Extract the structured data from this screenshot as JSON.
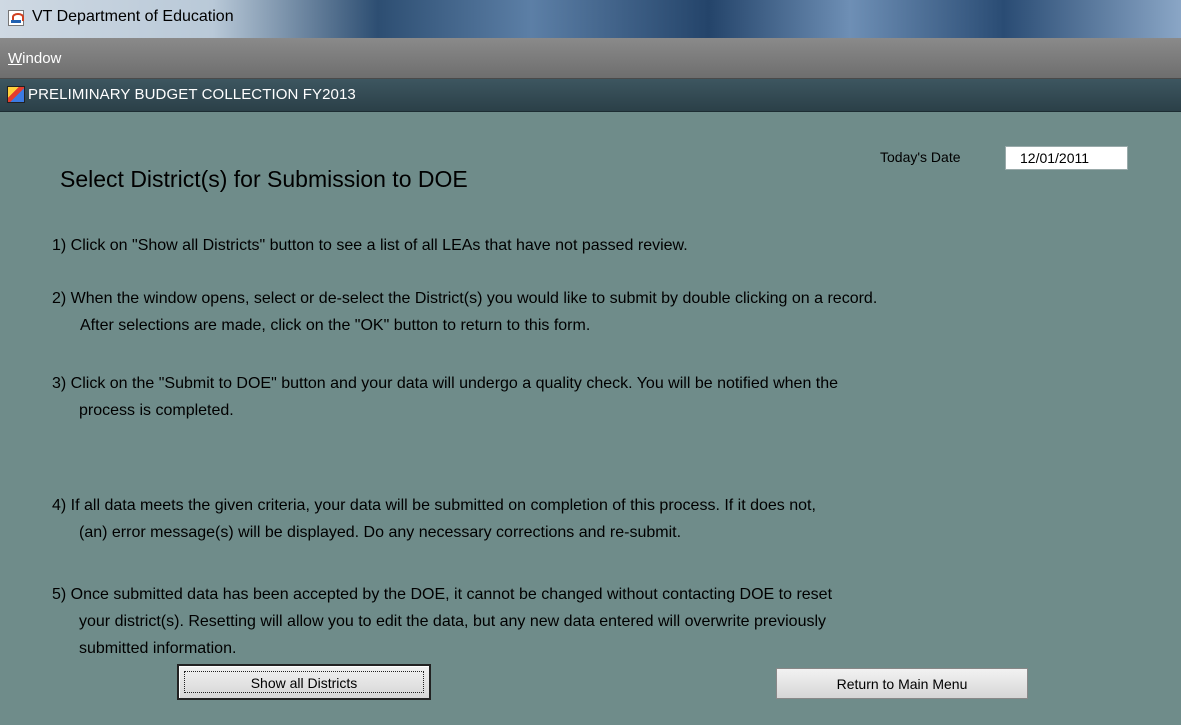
{
  "window": {
    "title": "VT Department of Education"
  },
  "menu": {
    "items": [
      {
        "mnemonic": "W",
        "rest": "indow"
      }
    ]
  },
  "frame": {
    "title": "PRELIMINARY BUDGET COLLECTION FY2013"
  },
  "form": {
    "heading": "Select District(s) for Submission to DOE",
    "date_label": "Today's Date",
    "date_value": "12/01/2011",
    "steps": [
      {
        "line1": "1)  Click on \"Show all Districts\" button to see a list of all LEAs that have not passed review.",
        "line2": ""
      },
      {
        "line1": "2) When the window opens, select or de-select the District(s) you would like to submit by double clicking on a record.",
        "line2": "After selections are made, click on the \"OK\" button to return to this form."
      },
      {
        "line1": "3) Click on the \"Submit to DOE\"  button and your data will undergo a quality check.   You will be notified when the",
        "line2": "process is completed."
      },
      {
        "line1": "4) If all data meets the given criteria, your data will be submitted on completion of this process.  If it  does not,",
        "line2": "(an) error message(s) will be displayed.  Do any necessary corrections and re-submit."
      },
      {
        "line1": "5) Once submitted data has been accepted by the DOE, it cannot be changed without contacting DOE to reset",
        "line2": "your district(s).  Resetting will allow you to edit the data, but any new data entered will overwrite previously",
        "line3": "submitted information."
      }
    ],
    "buttons": {
      "show_all": "Show all Districts",
      "return_main": "Return to Main Menu"
    }
  }
}
